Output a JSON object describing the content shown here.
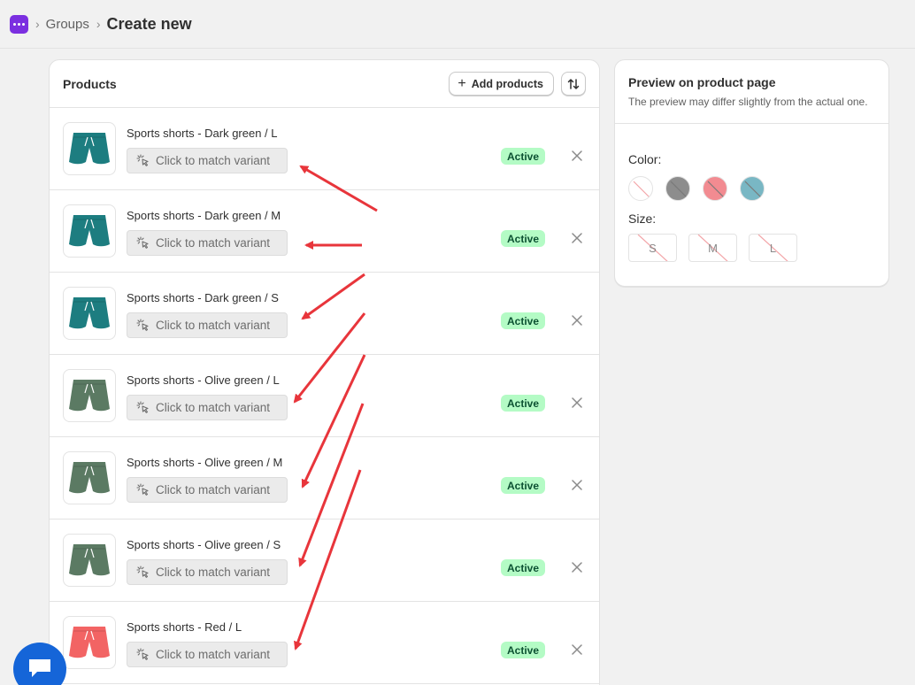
{
  "breadcrumb": {
    "app_icon": "app-logo-icon",
    "parent": "Groups",
    "current": "Create new"
  },
  "products": {
    "title": "Products",
    "add_button": "Add products",
    "sort_icon": "sort-arrows-icon",
    "match_label": "Click to match variant",
    "rows": [
      {
        "name": "Sports shorts - Dark green / L",
        "status": "Active",
        "color": "#1d7d80"
      },
      {
        "name": "Sports shorts - Dark green / M",
        "status": "Active",
        "color": "#1d7d80"
      },
      {
        "name": "Sports shorts - Dark green / S",
        "status": "Active",
        "color": "#1d7d80"
      },
      {
        "name": "Sports shorts - Olive green / L",
        "status": "Active",
        "color": "#5b7a63"
      },
      {
        "name": "Sports shorts - Olive green / M",
        "status": "Active",
        "color": "#5b7a63"
      },
      {
        "name": "Sports shorts - Olive green / S",
        "status": "Active",
        "color": "#5b7a63"
      },
      {
        "name": "Sports shorts - Red / L",
        "status": "Active",
        "color": "#f26464"
      }
    ]
  },
  "preview": {
    "title": "Preview on product page",
    "subtitle": "The preview may differ slightly from the actual one.",
    "color_label": "Color:",
    "size_label": "Size:",
    "colors": [
      "#ffffff",
      "#8d8d8d",
      "#f28b91",
      "#79b7c4"
    ],
    "sizes": [
      "S",
      "M",
      "L"
    ]
  },
  "colors": {
    "accent": "#7b2fe0",
    "badge_bg": "#b4fbc5",
    "badge_text": "#0c5132",
    "arrow": "#e8353b",
    "chat": "#1565d8"
  }
}
